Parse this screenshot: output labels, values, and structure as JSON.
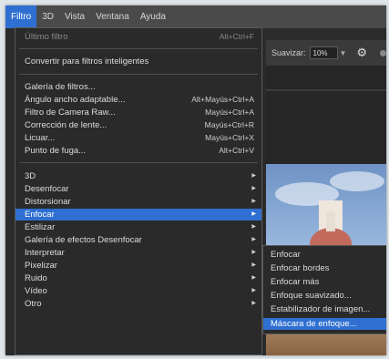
{
  "menubar": {
    "items": [
      "Filtro",
      "3D",
      "Vista",
      "Ventana",
      "Ayuda"
    ],
    "active_index": 0
  },
  "options": {
    "suavizar_label": "Suavizar:",
    "suavizar_value": "10%"
  },
  "filter_menu": {
    "items": [
      {
        "label": "Último filtro",
        "shortcut": "Alt+Ctrl+F",
        "disabled": true
      },
      {
        "label": "Convertir para filtros inteligentes"
      },
      {
        "label": "Galería de filtros..."
      },
      {
        "label": "Ángulo ancho adaptable...",
        "shortcut": "Alt+Mayús+Ctrl+A"
      },
      {
        "label": "Filtro de Camera Raw...",
        "shortcut": "Mayús+Ctrl+A"
      },
      {
        "label": "Corrección de lente...",
        "shortcut": "Mayús+Ctrl+R"
      },
      {
        "label": "Licuar...",
        "shortcut": "Mayús+Ctrl+X"
      },
      {
        "label": "Punto de fuga...",
        "shortcut": "Alt+Ctrl+V"
      },
      {
        "label": "3D",
        "submenu": true
      },
      {
        "label": "Desenfocar",
        "submenu": true
      },
      {
        "label": "Distorsionar",
        "submenu": true
      },
      {
        "label": "Enfocar",
        "submenu": true,
        "highlighted": true
      },
      {
        "label": "Estilizar",
        "submenu": true
      },
      {
        "label": "Galería de efectos Desenfocar",
        "submenu": true
      },
      {
        "label": "Interpretar",
        "submenu": true
      },
      {
        "label": "Pixelizar",
        "submenu": true
      },
      {
        "label": "Ruido",
        "submenu": true
      },
      {
        "label": "Vídeo",
        "submenu": true
      },
      {
        "label": "Otro",
        "submenu": true
      }
    ]
  },
  "enfocar_submenu": {
    "items": [
      {
        "label": "Enfocar"
      },
      {
        "label": "Enfocar bordes"
      },
      {
        "label": "Enfocar más"
      },
      {
        "label": "Enfoque suavizado..."
      },
      {
        "label": "Estabilizador de imagen..."
      },
      {
        "label": "Máscara de enfoque...",
        "highlighted": true
      }
    ]
  },
  "colors": {
    "accent": "#2f6fd1",
    "menu_bg": "#2a2a2a",
    "menubar_bg": "#4a4a4a"
  }
}
